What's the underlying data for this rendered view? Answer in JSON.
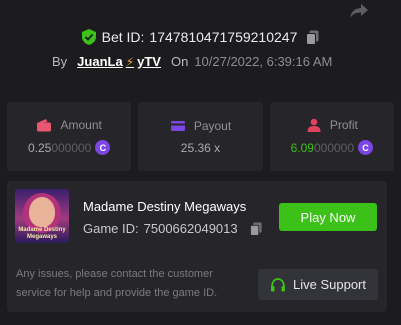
{
  "header": {
    "bet_id_label": "Bet ID:",
    "bet_id": "1747810471759210247",
    "by_label": "By",
    "user_part1": "JuanLa",
    "user_part2": "yTV",
    "on_label": "On",
    "date": "10/27/2022, 6:39:16 AM"
  },
  "stats": {
    "amount": {
      "label": "Amount",
      "value_main": "0.25",
      "value_dim": "000000"
    },
    "payout": {
      "label": "Payout",
      "value": "25.36 x"
    },
    "profit": {
      "label": "Profit",
      "value_main": "6.09",
      "value_dim": "000000"
    },
    "coin_symbol": "C"
  },
  "game": {
    "title": "Madame Destiny Megaways",
    "id_label": "Game ID:",
    "id": "7500662049013",
    "play_label": "Play Now",
    "help_text": "Any issues, please contact the customer service for help and provide the game ID.",
    "support_label": "Live Support"
  },
  "colors": {
    "accent_green": "#3bc117",
    "coin_purple": "#7c46e4",
    "amount_icon": "#e8566f",
    "payout_icon": "#7c46e4",
    "profit_icon": "#e0445c"
  },
  "icons": [
    "share-icon",
    "shield-check-icon",
    "copy-icon",
    "lightning-icon",
    "wallet-icon",
    "card-icon",
    "person-icon",
    "coin-icon",
    "headset-icon"
  ]
}
